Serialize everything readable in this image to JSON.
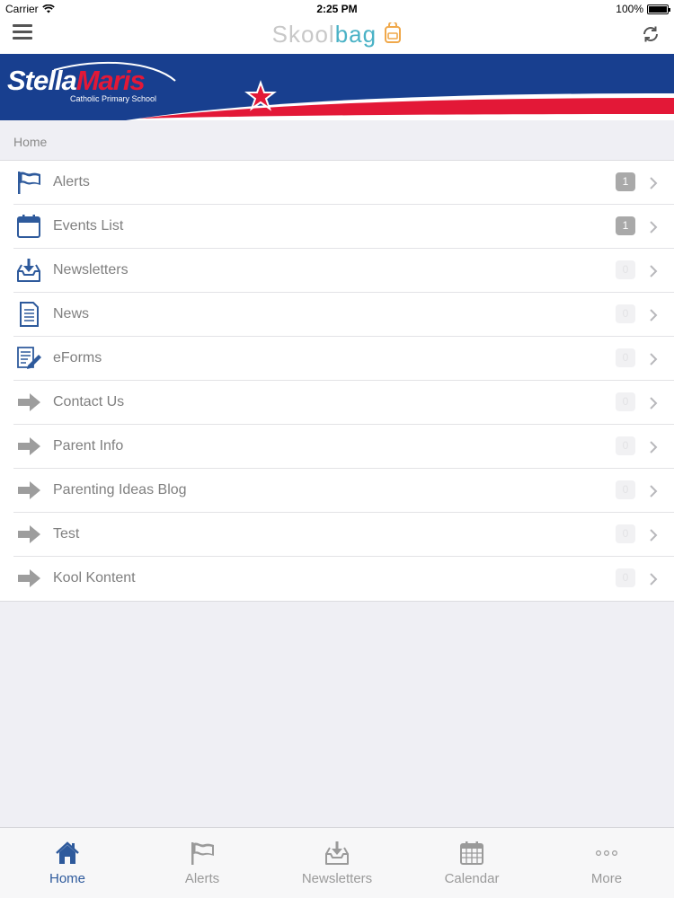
{
  "status_bar": {
    "carrier": "Carrier",
    "time": "2:25 PM",
    "battery": "100%"
  },
  "nav": {
    "title_part1": "Skool",
    "title_part2": "bag"
  },
  "banner": {
    "name_part1": "Stella",
    "name_part2": "Maris",
    "subtitle": "Catholic Primary School"
  },
  "breadcrumb": "Home",
  "menu": [
    {
      "label": "Alerts",
      "icon": "flag-icon",
      "badge": "1"
    },
    {
      "label": "Events List",
      "icon": "calendar-icon",
      "badge": "1"
    },
    {
      "label": "Newsletters",
      "icon": "inbox-download-icon",
      "badge": "0"
    },
    {
      "label": "News",
      "icon": "document-icon",
      "badge": "0"
    },
    {
      "label": "eForms",
      "icon": "form-edit-icon",
      "badge": "0"
    },
    {
      "label": "Contact Us",
      "icon": "arrow-right-icon",
      "badge": "0"
    },
    {
      "label": "Parent Info",
      "icon": "arrow-right-icon",
      "badge": "0"
    },
    {
      "label": "Parenting Ideas Blog",
      "icon": "arrow-right-icon",
      "badge": "0"
    },
    {
      "label": "Test",
      "icon": "arrow-right-icon",
      "badge": "0"
    },
    {
      "label": "Kool Kontent",
      "icon": "arrow-right-icon",
      "badge": "0"
    }
  ],
  "tabs": [
    {
      "label": "Home",
      "icon": "home-icon",
      "selected": true
    },
    {
      "label": "Alerts",
      "icon": "flag-icon"
    },
    {
      "label": "Newsletters",
      "icon": "inbox-download-icon"
    },
    {
      "label": "Calendar",
      "icon": "calendar-grid-icon"
    },
    {
      "label": "More",
      "icon": "more-dots-icon"
    }
  ],
  "colors": {
    "brand_blue": "#183f8f",
    "brand_red": "#e31837",
    "accent": "#2e5a9c",
    "badge_active": "#a9a9a9"
  }
}
